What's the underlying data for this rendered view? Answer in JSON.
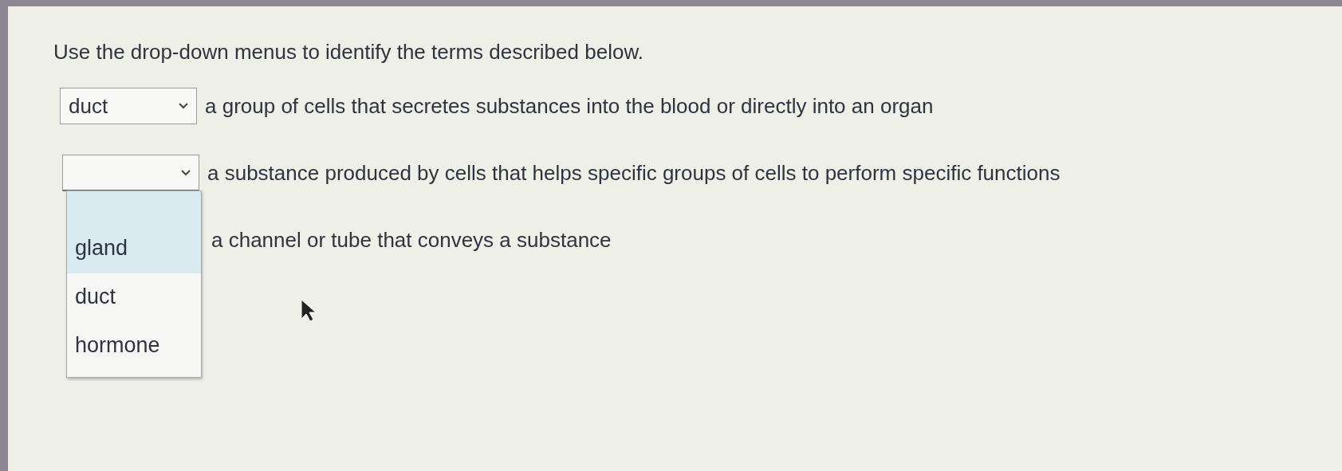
{
  "instruction": "Use the drop-down menus to identify the terms described below.",
  "items": [
    {
      "value": "duct",
      "description": "a group of cells that secretes substances into the blood or directly into an organ"
    },
    {
      "open": true,
      "description": "a substance produced by cells that helps specific groups of cells to perform specific functions",
      "options": [
        {
          "label": "gland",
          "highlighted": true
        },
        {
          "label": "duct",
          "highlighted": false
        },
        {
          "label": "hormone",
          "highlighted": false
        }
      ]
    },
    {
      "description": "a channel or tube that conveys a substance"
    }
  ]
}
